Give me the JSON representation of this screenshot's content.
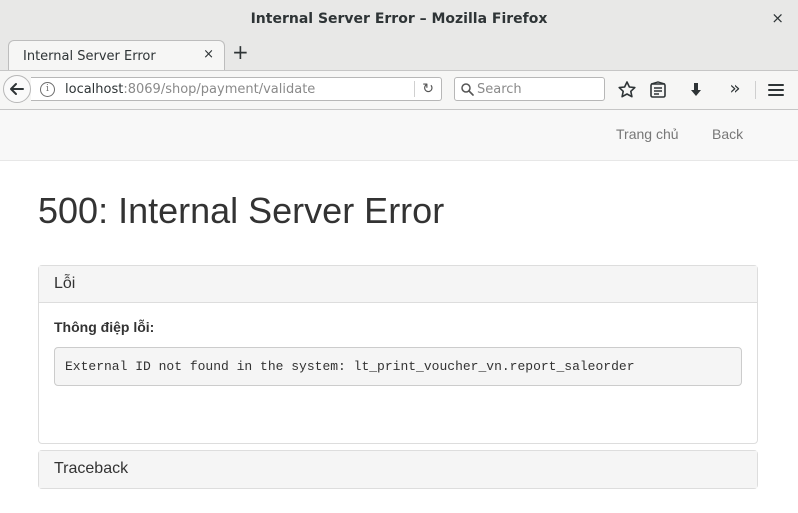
{
  "window": {
    "title": "Internal Server Error – Mozilla Firefox",
    "close_glyph": "×"
  },
  "tabs": [
    {
      "label": "Internal Server Error",
      "close_glyph": "×",
      "active": true
    }
  ],
  "new_tab_glyph": "+",
  "navbar": {
    "url_host": "localhost",
    "url_rest": ":8069/shop/payment/validate",
    "info_glyph": "i",
    "reload_glyph": "↻",
    "search_placeholder": "Search",
    "overflow_glyph": "»",
    "icons": [
      "back-icon",
      "info-icon",
      "reload-icon",
      "search-icon",
      "star-icon",
      "reading-list-icon",
      "download-icon",
      "overflow-icon",
      "menu-icon"
    ]
  },
  "site_nav": {
    "home": "Trang chủ",
    "back": "Back"
  },
  "page": {
    "title": "500: Internal Server Error"
  },
  "error_panel": {
    "heading": "Lỗi",
    "message_label": "Thông điệp lỗi:",
    "message": "External ID not found in the system: lt_print_voucher_vn.report_saleorder"
  },
  "traceback_panel": {
    "heading": "Traceback"
  }
}
